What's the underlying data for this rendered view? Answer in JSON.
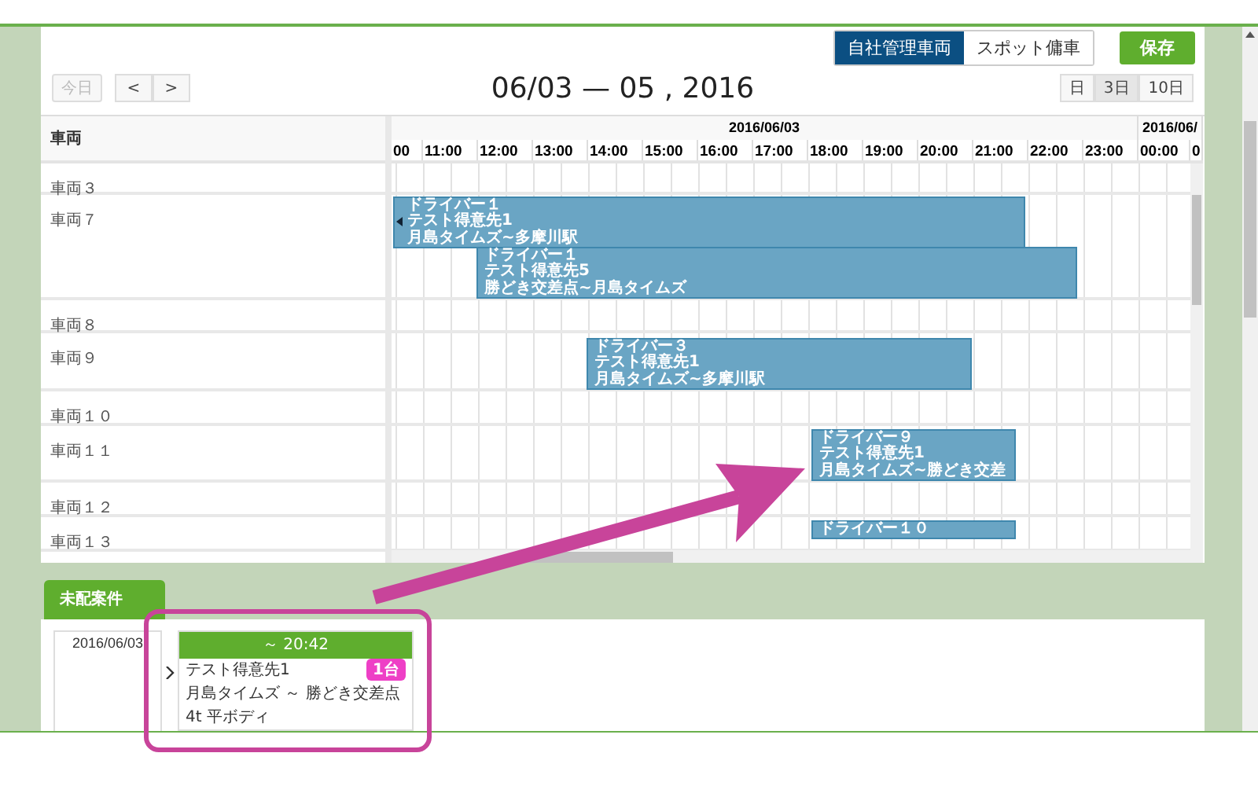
{
  "toolbar": {
    "modes": [
      {
        "label": "自社管理車両",
        "selected": true
      },
      {
        "label": "スポット傭車",
        "selected": false
      }
    ],
    "save": "保存"
  },
  "nav": {
    "today": {
      "label": "今日",
      "disabled": true
    },
    "prev": "<",
    "next": ">",
    "title": "06/03 — 05 , 2016",
    "views": [
      {
        "label": "日",
        "selected": false
      },
      {
        "label": "3日",
        "selected": true
      },
      {
        "label": "10日",
        "selected": false
      }
    ]
  },
  "timeline": {
    "column_header": "車両",
    "dates": [
      "2016/06/03",
      "2016/06/"
    ],
    "hours": [
      "00",
      "11:00",
      "12:00",
      "13:00",
      "14:00",
      "15:00",
      "16:00",
      "17:00",
      "18:00",
      "19:00",
      "20:00",
      "21:00",
      "22:00",
      "23:00",
      "00:00",
      "0"
    ],
    "rows": [
      {
        "vehicle": "車両３",
        "events": []
      },
      {
        "vehicle": "車両７",
        "events": [
          {
            "lines": [
              "ドライバー１",
              "テスト得意先1",
              "月島タイムズ~多摩川駅"
            ],
            "continues_left": true
          },
          {
            "lines": [
              "ドライバー１",
              "テスト得意先5",
              "勝どき交差点~月島タイムズ"
            ],
            "continues_left": false
          }
        ]
      },
      {
        "vehicle": "車両８",
        "events": []
      },
      {
        "vehicle": "車両９",
        "events": [
          {
            "lines": [
              "ドライバー３",
              "テスト得意先1",
              "月島タイムズ~多摩川駅"
            ],
            "continues_left": false
          }
        ]
      },
      {
        "vehicle": "車両１０",
        "events": []
      },
      {
        "vehicle": "車両１１",
        "events": [
          {
            "lines": [
              "ドライバー９",
              "テスト得意先1",
              "月島タイムズ~勝どき交差"
            ],
            "continues_left": false
          }
        ]
      },
      {
        "vehicle": "車両１２",
        "events": []
      },
      {
        "vehicle": "車両１３",
        "events": [
          {
            "lines": [
              "ドライバー１０"
            ],
            "continues_left": false
          }
        ]
      }
    ]
  },
  "unassigned": {
    "tab": "未配案件",
    "date": "2016/06/03",
    "card": {
      "time": "～ 20:42",
      "customer": "テスト得意先1",
      "badge": "1台",
      "route": "月島タイムズ ～ 勝どき交差点",
      "vehicle_type": "4t 平ボディ"
    }
  }
}
